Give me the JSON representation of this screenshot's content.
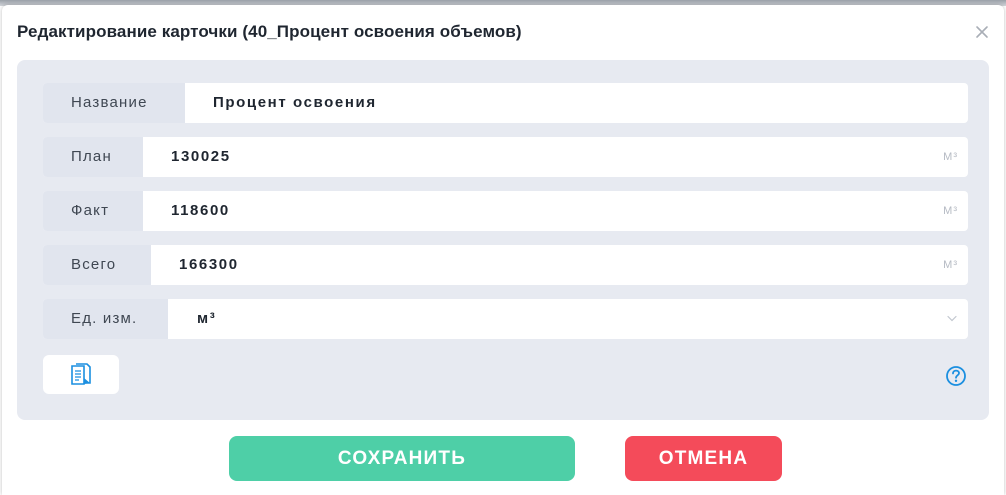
{
  "dialog": {
    "title": "Редактирование карточки (40_Процент освоения объемов)",
    "close_icon": "close-icon"
  },
  "form": {
    "name": {
      "label": "Название",
      "value": "Процент освоения"
    },
    "plan": {
      "label": "План",
      "value": "130025",
      "unit": "М³"
    },
    "fact": {
      "label": "Факт",
      "value": "118600",
      "unit": "М³"
    },
    "total": {
      "label": "Всего",
      "value": "166300",
      "unit": "М³"
    },
    "unit_select": {
      "label": "Ед. изм.",
      "value": "м³",
      "icon": "chevron-down-icon"
    }
  },
  "toolbar": {
    "document_icon": "document-icon",
    "help_icon": "help-icon"
  },
  "buttons": {
    "save_label": "СОХРАНИТЬ",
    "cancel_label": "ОТМЕНА"
  },
  "colors": {
    "panel_bg": "#e7eaf1",
    "label_bg": "#e1e5ee",
    "save": "#4ecfa7",
    "cancel": "#f44b5a",
    "accent": "#1b8fe0"
  }
}
